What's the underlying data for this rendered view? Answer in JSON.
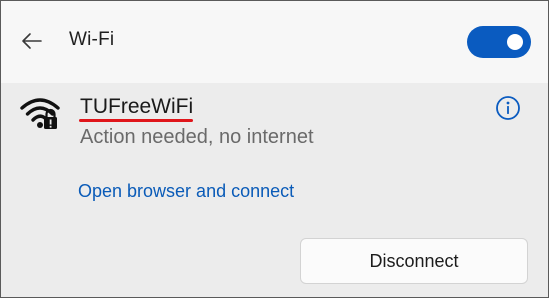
{
  "header": {
    "back_icon": "arrow-left",
    "title": "Wi-Fi",
    "wifi_toggle": {
      "state": "on",
      "color": "#0a5bc0"
    }
  },
  "network": {
    "icon": "wifi-secured-warning",
    "name": "TUFreeWiFi",
    "name_annotation_color": "#e0161b",
    "status": "Action needed, no internet",
    "info_icon": "info-circle",
    "connect_link": "Open browser and connect",
    "disconnect_label": "Disconnect"
  },
  "colors": {
    "accent": "#0a5bc0",
    "link": "#0a5bb8",
    "header_bg": "#f7f7f7",
    "card_bg": "#ececec"
  }
}
